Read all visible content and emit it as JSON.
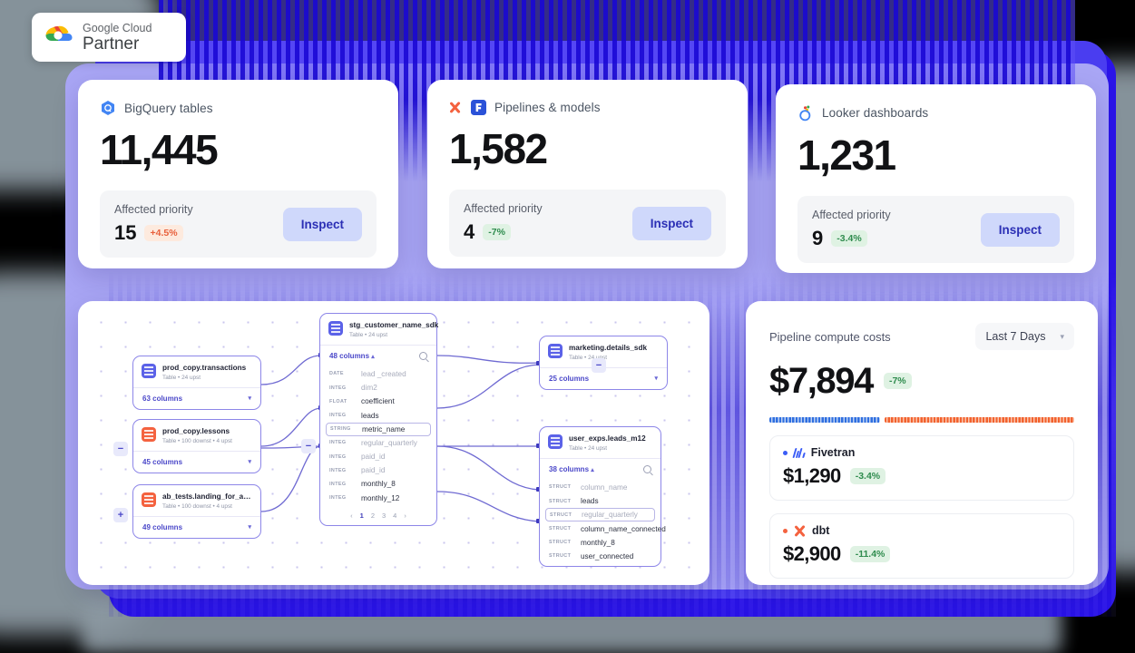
{
  "badge": {
    "line1": "Google Cloud",
    "line2": "Partner",
    "icon": "google-cloud-logo"
  },
  "stats": [
    {
      "icon": "bigquery-icon",
      "title": "BigQuery tables",
      "value": "11,445",
      "sub_label": "Affected priority",
      "sub_value": "15",
      "delta": "+4.5%",
      "delta_dir": "up",
      "button": "Inspect"
    },
    {
      "icon": "dbt-fivetran-icon",
      "title": "Pipelines & models",
      "value": "1,582",
      "sub_label": "Affected priority",
      "sub_value": "4",
      "delta": "-7%",
      "delta_dir": "down",
      "button": "Inspect"
    },
    {
      "icon": "looker-icon",
      "title": "Looker dashboards",
      "value": "1,231",
      "sub_label": "Affected priority",
      "sub_value": "9",
      "delta": "-3.4%",
      "delta_dir": "down",
      "button": "Inspect"
    }
  ],
  "lineage": {
    "left_nodes": [
      {
        "title": "prod_copy.transactions",
        "meta": "Table • 24 upst",
        "columns": "63 columns",
        "icon_color": "blue"
      },
      {
        "title": "prod_copy.lessons",
        "meta": "Table • 100 downst • 4 upst",
        "columns": "45 columns",
        "icon_color": "red"
      },
      {
        "title": "ab_tests.landing_for_ab_ge...",
        "meta": "Table • 100 downst • 4 upst",
        "columns": "49 columns",
        "icon_color": "red"
      }
    ],
    "center_node": {
      "title": "stg_customer_name_sdk",
      "meta": "Table • 24 upst",
      "columns": "48 columns",
      "search_icon": "search-icon",
      "fields": [
        {
          "type": "DATE",
          "name": "lead _created",
          "dim": true,
          "sel": false
        },
        {
          "type": "INTEG",
          "name": "dim2",
          "dim": true,
          "sel": false
        },
        {
          "type": "FLOAT",
          "name": "coefficient",
          "dim": false,
          "sel": false
        },
        {
          "type": "INTEG",
          "name": "leads",
          "dim": false,
          "sel": false
        },
        {
          "type": "STRING",
          "name": "metric_name",
          "dim": false,
          "sel": true
        },
        {
          "type": "INTEG",
          "name": "regular_quarterly",
          "dim": true,
          "sel": false
        },
        {
          "type": "INTEG",
          "name": "paid_id",
          "dim": true,
          "sel": false
        },
        {
          "type": "INTEG",
          "name": "paid_id",
          "dim": true,
          "sel": false
        },
        {
          "type": "INTEG",
          "name": "monthly_8",
          "dim": false,
          "sel": false
        },
        {
          "type": "INTEG",
          "name": "monthly_12",
          "dim": false,
          "sel": false
        }
      ],
      "pager": {
        "prev": "‹",
        "pages": [
          "1",
          "2",
          "3",
          "4"
        ],
        "current": "1",
        "next": "›"
      }
    },
    "right_top_node": {
      "title": "marketing.details_sdk",
      "meta": "Table • 24 upst",
      "columns": "25 columns",
      "icon_color": "blue"
    },
    "right_bottom_node": {
      "title": "user_exps.leads_m12",
      "meta": "Table • 24 upst",
      "columns": "38 columns",
      "icon_color": "blue",
      "search_icon": "search-icon",
      "fields": [
        {
          "type": "STRUCT",
          "name": "column_name",
          "dim": true,
          "sel": false
        },
        {
          "type": "STRUCT",
          "name": "leads",
          "dim": false,
          "sel": false
        },
        {
          "type": "STRUCT",
          "name": "regular_quarterly",
          "dim": true,
          "sel": true
        },
        {
          "type": "STRUCT",
          "name": "column_name_connected",
          "dim": false,
          "sel": false
        },
        {
          "type": "STRUCT",
          "name": "monthly_8",
          "dim": false,
          "sel": false
        },
        {
          "type": "STRUCT",
          "name": "user_connected",
          "dim": false,
          "sel": false
        }
      ]
    },
    "zoom_buttons": [
      {
        "label": "−",
        "name": "collapse-button-left-mid"
      },
      {
        "label": "+",
        "name": "expand-button-left-bottom"
      },
      {
        "label": "−",
        "name": "collapse-button-center"
      },
      {
        "label": "−",
        "name": "collapse-button-right"
      }
    ]
  },
  "costs": {
    "title": "Pipeline compute costs",
    "range": "Last 7 Days",
    "range_chevron": "chevron-down-icon",
    "total": "$7,894",
    "total_delta": "-7%",
    "vendors": [
      {
        "name": "Fivetran",
        "amount": "$1,290",
        "delta": "-3.4%",
        "color": "#3b5df6",
        "logo": "fivetran-logo"
      },
      {
        "name": "dbt",
        "amount": "$2,900",
        "delta": "-11.4%",
        "color": "#f4623f",
        "logo": "dbt-logo"
      }
    ]
  },
  "chart_data": {
    "type": "bar",
    "title": "Pipeline compute costs",
    "categories": [
      "Fivetran",
      "dbt"
    ],
    "values": [
      1290,
      2900
    ],
    "unit": "USD",
    "total": 7894,
    "share_percent": [
      37,
      63
    ],
    "legend_position": "inline",
    "grid": false
  }
}
